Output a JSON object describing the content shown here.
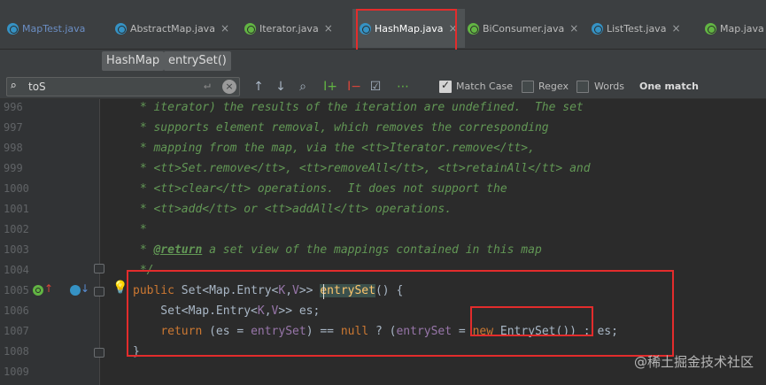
{
  "tabs": [
    {
      "label": "MapTest.java",
      "kind": "c",
      "active": false
    },
    {
      "label": "AbstractMap.java",
      "kind": "c",
      "active": false
    },
    {
      "label": "Iterator.java",
      "kind": "i",
      "active": false
    },
    {
      "label": "HashMap.java",
      "kind": "c",
      "active": true
    },
    {
      "label": "BiConsumer.java",
      "kind": "i",
      "active": false
    },
    {
      "label": "ListTest.java",
      "kind": "c",
      "active": false
    },
    {
      "label": "Map.java",
      "kind": "i",
      "active": false
    }
  ],
  "tab_close_glyph": "×",
  "breadcrumb": {
    "class_name": "HashMap",
    "method_name": "entrySet()"
  },
  "find": {
    "query": "toS",
    "match_case": {
      "label": "Match Case",
      "checked": true
    },
    "regex": {
      "label": "Regex",
      "checked": false
    },
    "words": {
      "label": "Words",
      "checked": false
    },
    "result": "One match"
  },
  "lines": [
    {
      "num": "996",
      "segments": [
        {
          "t": " * iterator) the results of the iteration are undefined.  The set",
          "c": "doc"
        }
      ]
    },
    {
      "num": "997",
      "segments": [
        {
          "t": " * supports element removal, which removes the corresponding",
          "c": "doc"
        }
      ]
    },
    {
      "num": "998",
      "segments": [
        {
          "t": " * mapping from the map, via the <tt>Iterator.remove</tt>,",
          "c": "doc"
        }
      ]
    },
    {
      "num": "999",
      "segments": [
        {
          "t": " * <tt>Set.remove</tt>, <tt>removeAll</tt>, <tt>retainAll</tt> and",
          "c": "doc"
        }
      ]
    },
    {
      "num": "1000",
      "segments": [
        {
          "t": " * <tt>clear</tt> operations.  It does not support the",
          "c": "doc"
        }
      ]
    },
    {
      "num": "1001",
      "segments": [
        {
          "t": " * <tt>add</tt> or <tt>addAll</tt> operations.",
          "c": "doc"
        }
      ]
    },
    {
      "num": "1002",
      "segments": [
        {
          "t": " *",
          "c": "doc"
        }
      ]
    },
    {
      "num": "1003",
      "segments": [
        {
          "t": " * ",
          "c": "doc"
        },
        {
          "t": "@return",
          "c": "doc-tag"
        },
        {
          "t": " a set view of the mappings contained in this map",
          "c": "doc"
        }
      ]
    },
    {
      "num": "1004",
      "segments": [
        {
          "t": " */",
          "c": "doc"
        }
      ]
    },
    {
      "num": "1005",
      "segments": [
        {
          "t": "public ",
          "c": "kw"
        },
        {
          "t": "Set<Map.Entry<",
          "c": "pl"
        },
        {
          "t": "K",
          "c": "tp"
        },
        {
          "t": ",",
          "c": "pl"
        },
        {
          "t": "V",
          "c": "tp"
        },
        {
          "t": ">> ",
          "c": "pl"
        },
        {
          "t": "entrySet",
          "c": "fn"
        },
        {
          "t": "() {",
          "c": "pl"
        }
      ]
    },
    {
      "num": "1006",
      "segments": [
        {
          "t": "    Set<Map.Entry<",
          "c": "pl"
        },
        {
          "t": "K",
          "c": "tp"
        },
        {
          "t": ",",
          "c": "pl"
        },
        {
          "t": "V",
          "c": "tp"
        },
        {
          "t": ">> es;",
          "c": "pl"
        }
      ]
    },
    {
      "num": "1007",
      "segments": [
        {
          "t": "    ",
          "c": "pl"
        },
        {
          "t": "return ",
          "c": "kw"
        },
        {
          "t": "(es = ",
          "c": "pl"
        },
        {
          "t": "entrySet",
          "c": "tp"
        },
        {
          "t": ") == ",
          "c": "pl"
        },
        {
          "t": "null",
          "c": "kw"
        },
        {
          "t": " ? (",
          "c": "pl"
        },
        {
          "t": "entrySet",
          "c": "tp"
        },
        {
          "t": " = ",
          "c": "pl"
        },
        {
          "t": "new ",
          "c": "kw"
        },
        {
          "t": "EntrySet()) : es;",
          "c": "pl"
        }
      ]
    },
    {
      "num": "1008",
      "segments": [
        {
          "t": "}",
          "c": "pl"
        }
      ]
    },
    {
      "num": "1009",
      "segments": []
    }
  ],
  "watermark": "@稀土掘金技术社区",
  "colors": {
    "annotation_red": "#e32c2c",
    "comment_green": "#629755",
    "keyword_orange": "#cc7832"
  }
}
